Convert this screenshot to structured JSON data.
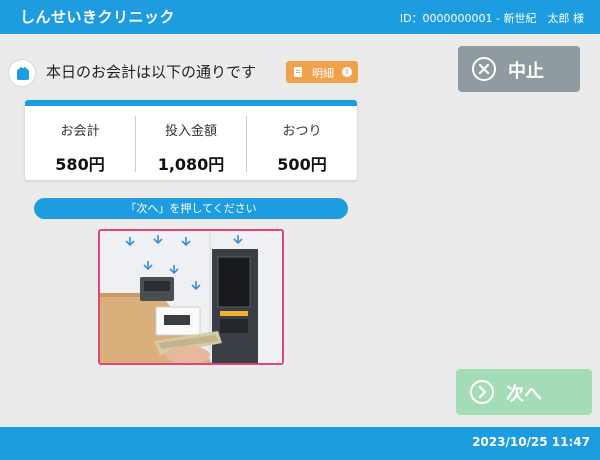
{
  "header": {
    "clinic_name": "しんせいきクリニック",
    "user_info": "ID：0000000001 - 新世紀　太郎 様"
  },
  "prompt": {
    "text": "本日のお会計は以下の通りです",
    "detail_button": "明細",
    "info_icon": "i"
  },
  "totals": [
    {
      "label": "お会計",
      "value": "580円"
    },
    {
      "label": "投入金額",
      "value": "1,080円"
    },
    {
      "label": "おつり",
      "value": "500円"
    }
  ],
  "instruction": "「次へ」を押してください",
  "buttons": {
    "cancel": "中止",
    "next": "次へ"
  },
  "footer": {
    "datetime": "2023/10/25 11:47"
  },
  "icons": {
    "wallet": "wallet-icon",
    "detail": "document-icon",
    "cancel": "close-circle-icon",
    "next": "arrow-right-circle-icon"
  },
  "colors": {
    "header_blue": "#1e9ce0",
    "cancel_gray": "#8f9aa1",
    "next_green": "#a5dcb8",
    "detail_orange": "#f0a24a",
    "image_border_pink": "#e04778"
  }
}
